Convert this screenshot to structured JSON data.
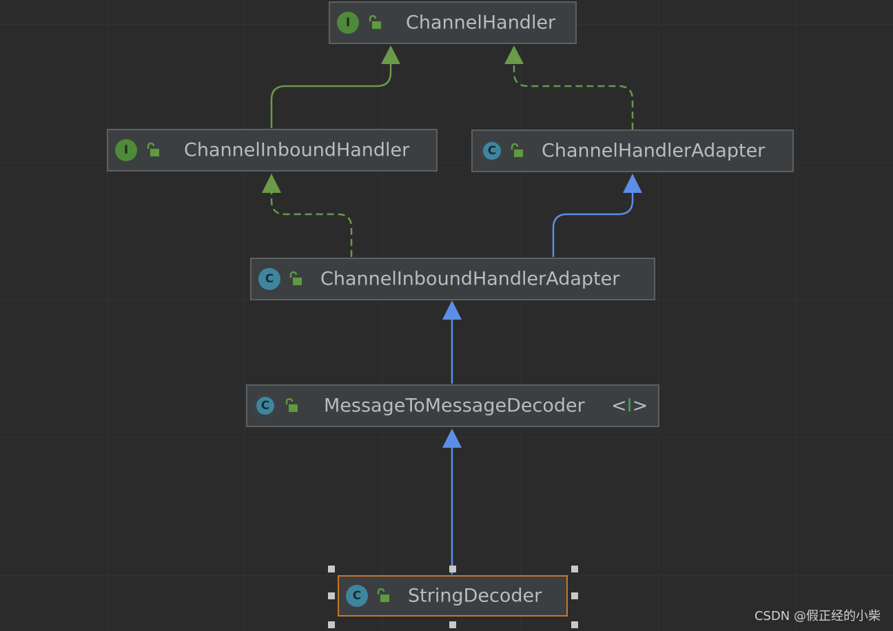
{
  "diagram": {
    "nodes": [
      {
        "id": "channel-handler",
        "kind": "interface",
        "badge": "I",
        "label": "ChannelHandler"
      },
      {
        "id": "channel-inbound-handler",
        "kind": "interface",
        "badge": "I",
        "label": "ChannelInboundHandler"
      },
      {
        "id": "channel-handler-adapter",
        "kind": "abstract-class",
        "badge": "C",
        "label": "ChannelHandlerAdapter"
      },
      {
        "id": "channel-inbound-handler-adapter",
        "kind": "class",
        "badge": "C",
        "label": "ChannelInboundHandlerAdapter"
      },
      {
        "id": "message-to-message-decoder",
        "kind": "abstract-class",
        "badge": "C",
        "label": "MessageToMessageDecoder",
        "type_param_open": "<",
        "type_param": "I",
        "type_param_close": ">"
      },
      {
        "id": "string-decoder",
        "kind": "class",
        "badge": "C",
        "label": "StringDecoder",
        "selected": true
      }
    ],
    "edges": [
      {
        "from": "channel-inbound-handler",
        "to": "channel-handler",
        "type": "extends",
        "color": "#6a9a4a"
      },
      {
        "from": "channel-handler-adapter",
        "to": "channel-handler",
        "type": "implements",
        "color": "#6a9a4a"
      },
      {
        "from": "channel-inbound-handler-adapter",
        "to": "channel-inbound-handler",
        "type": "implements",
        "color": "#6a9a4a"
      },
      {
        "from": "channel-inbound-handler-adapter",
        "to": "channel-handler-adapter",
        "type": "extends",
        "color": "#5b8ee6"
      },
      {
        "from": "message-to-message-decoder",
        "to": "channel-inbound-handler-adapter",
        "type": "extends",
        "color": "#5b8ee6"
      },
      {
        "from": "string-decoder",
        "to": "message-to-message-decoder",
        "type": "extends",
        "color": "#5b8ee6"
      }
    ]
  },
  "colors": {
    "background": "#2b2b2b",
    "node_fill": "#3c3f41",
    "node_border": "#5e6060",
    "selected_border": "#c8782a",
    "interface_badge": "#4f8a3a",
    "class_badge": "#3e86a0",
    "green_edge": "#6a9a4a",
    "blue_edge": "#5b8ee6",
    "lock_icon": "#5f9a3e"
  },
  "watermark": "CSDN @假正经的小柴"
}
